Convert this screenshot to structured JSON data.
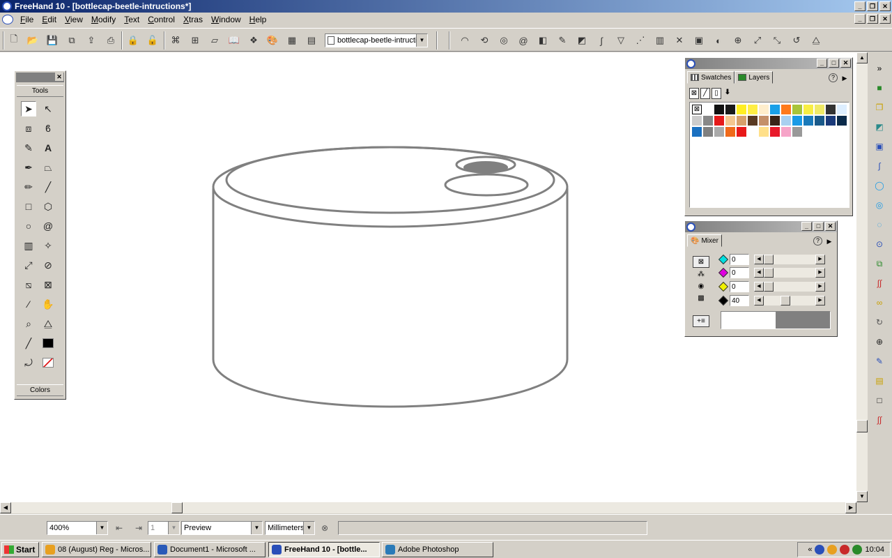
{
  "window": {
    "title": "FreeHand 10 - [bottlecap-beetle-intructions*]",
    "buttons": [
      "_",
      "❐",
      "✕"
    ]
  },
  "menu": [
    "File",
    "Edit",
    "View",
    "Modify",
    "Text",
    "Control",
    "Xtras",
    "Window",
    "Help"
  ],
  "toolbar": {
    "document_select": "bottlecap-beetle-intructions",
    "left_icons": [
      "new-icon",
      "open-icon",
      "save-icon",
      "import-icon",
      "export-icon",
      "print-icon",
      "lock-icon",
      "unlock-icon",
      "group-icon",
      "ungroup-icon",
      "align-icon",
      "library-icon",
      "symbols-icon",
      "color-icon",
      "grid-icon",
      "layers-icon"
    ],
    "right_icons": [
      "arc-icon",
      "3d-rotation-icon",
      "fisheye-icon",
      "spiral-icon",
      "smudge-icon",
      "eyedropper-icon",
      "shadow-icon",
      "roughen-icon",
      "bend-icon",
      "trace-icon",
      "graph-icon",
      "envelope-icon",
      "blend-icon",
      "extrude-icon",
      "zoom-icon",
      "transform-icon",
      "rotate-icon",
      "mirror-icon"
    ]
  },
  "tools_panel": {
    "label": "Tools",
    "colors_label": "Colors",
    "tools": [
      "pointer-icon",
      "subselect-icon",
      "page-icon",
      "lasso-icon",
      "eyedropper-icon",
      "text-icon",
      "pen-icon",
      "bezigon-icon",
      "pencil-icon",
      "line-icon",
      "rectangle-icon",
      "polygon-icon",
      "ellipse-icon",
      "spiral-icon",
      "trace-icon",
      "freeform-icon",
      "scale-icon",
      "rotate-icon",
      "skew-icon",
      "reflect-icon",
      "knife-icon",
      "hand-icon",
      "zoom-icon",
      "mirror-icon",
      "stroke-color-icon",
      "fill-swatch-icon",
      "swap-icon",
      "none-color-icon"
    ]
  },
  "swatches_panel": {
    "tabs": [
      "Swatches",
      "Layers"
    ],
    "help": "?",
    "colors": [
      "#000000",
      "#ffffff",
      "#111111",
      "#1a1a1a",
      "#ffee22",
      "#ffee44",
      "#ffeecc",
      "#1aa0e8",
      "#ff7a1a",
      "#a8c43a",
      "#f8ee44",
      "#f0ea66",
      "#333333",
      "#ddeeff",
      "#cccccc",
      "#888888",
      "#e51a1a",
      "#f4c790",
      "#d7a06a",
      "#5a3a22",
      "#c4906a",
      "#3a2418",
      "#a8d0f0",
      "#1a9ae6",
      "#1a7aba",
      "#1a5a8a",
      "#1a3a7a",
      "#0a2a4a",
      "#1a70c0",
      "#808080",
      "#aaaaaa",
      "#f06a1a",
      "#e81a1a",
      "#ffffff",
      "#ffe08a",
      "#e81a2a",
      "#f6a4c8",
      "#999999"
    ]
  },
  "mixer_panel": {
    "tab": "Mixer",
    "help": "?",
    "channels": [
      {
        "name": "cyan",
        "color": "#00e0e0",
        "value": "0"
      },
      {
        "name": "magenta",
        "color": "#e000e0",
        "value": "0"
      },
      {
        "name": "yellow",
        "color": "#f0f000",
        "value": "0"
      },
      {
        "name": "black",
        "color": "#000000",
        "value": "40"
      }
    ]
  },
  "status": {
    "zoom": "400%",
    "page": "1",
    "view_mode": "Preview",
    "units": "Millimeters"
  },
  "taskbar": {
    "start": "Start",
    "tasks": [
      {
        "label": "08 (August) Reg - Micros...",
        "color": "#e8a020"
      },
      {
        "label": "Document1 - Microsoft ...",
        "color": "#2a5ab8"
      },
      {
        "label": "FreeHand 10 - [bottle...",
        "color": "#2a4fb8"
      },
      {
        "label": "Adobe Photoshop",
        "color": "#2a7ab8"
      }
    ],
    "clock": "10:04",
    "tray_arrow": "«"
  }
}
